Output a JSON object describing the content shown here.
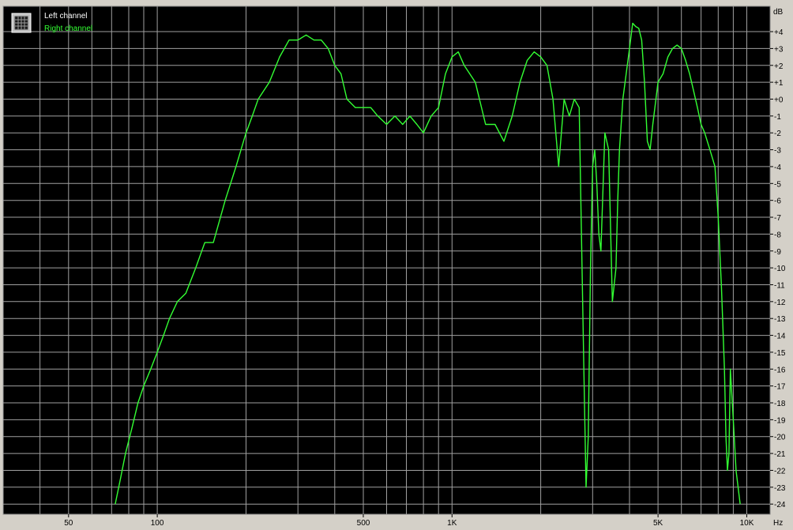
{
  "legend": {
    "icon": "spectrum-grid-icon",
    "entries": [
      {
        "label": "Left channel",
        "color": "#ffffff"
      },
      {
        "label": "Right channel",
        "color": "#33ff33"
      }
    ]
  },
  "colors": {
    "plot_background": "#000000",
    "grid": "#a0a0a0",
    "frame": "#d4d0c8",
    "axis_text": "#000000",
    "trace": "#33ff33"
  },
  "chart_data": {
    "type": "line",
    "x_scale": "log",
    "xlim": [
      30,
      12000
    ],
    "ylim": [
      -24.6,
      5.5
    ],
    "x_unit": "Hz",
    "y_unit": "dB",
    "x_ticks": [
      {
        "value": 50,
        "label": "50"
      },
      {
        "value": 100,
        "label": "100"
      },
      {
        "value": 500,
        "label": "500"
      },
      {
        "value": 1000,
        "label": "1K"
      },
      {
        "value": 5000,
        "label": "5K"
      },
      {
        "value": 10000,
        "label": "10K"
      }
    ],
    "x_gridlines": [
      30,
      40,
      50,
      60,
      70,
      80,
      90,
      100,
      200,
      300,
      400,
      500,
      600,
      700,
      800,
      900,
      1000,
      2000,
      3000,
      4000,
      5000,
      6000,
      7000,
      8000,
      9000,
      10000
    ],
    "y_ticks": [
      4,
      3,
      2,
      1,
      0,
      -1,
      -2,
      -3,
      -4,
      -5,
      -6,
      -7,
      -8,
      -9,
      -10,
      -11,
      -12,
      -13,
      -14,
      -15,
      -16,
      -17,
      -18,
      -19,
      -20,
      -21,
      -22,
      -23,
      -24
    ],
    "y_tick_labels": [
      "+4",
      "+3",
      "+2",
      "+1",
      "+0",
      "-1",
      "-2",
      "-3",
      "-4",
      "-5",
      "-6",
      "-7",
      "-8",
      "-9",
      "-10",
      "-11",
      "-12",
      "-13",
      "-14",
      "-15",
      "-16",
      "-17",
      "-18",
      "-19",
      "-20",
      "-21",
      "-22",
      "-23",
      "-24"
    ],
    "grid": true,
    "legend_position": "top-left",
    "series": [
      {
        "name": "Right channel",
        "color": "#33ff33",
        "x": [
          72,
          75,
          78,
          82,
          86,
          90,
          95,
          100,
          105,
          110,
          117,
          125,
          135,
          145,
          155,
          170,
          185,
          200,
          210,
          220,
          240,
          260,
          280,
          300,
          320,
          340,
          360,
          380,
          400,
          420,
          440,
          470,
          500,
          530,
          560,
          600,
          640,
          680,
          720,
          760,
          800,
          850,
          900,
          950,
          1000,
          1050,
          1100,
          1200,
          1300,
          1400,
          1500,
          1600,
          1700,
          1800,
          1900,
          2000,
          2100,
          2200,
          2300,
          2400,
          2500,
          2600,
          2700,
          2800,
          2850,
          2900,
          2950,
          3000,
          3050,
          3100,
          3150,
          3200,
          3300,
          3400,
          3500,
          3600,
          3650,
          3700,
          3800,
          4000,
          4100,
          4200,
          4300,
          4400,
          4500,
          4600,
          4700,
          4800,
          5000,
          5200,
          5400,
          5600,
          5800,
          6000,
          6200,
          6400,
          6600,
          6800,
          7000,
          7200,
          7500,
          7800,
          8000,
          8200,
          8400,
          8500,
          8600,
          8700,
          8800,
          9000,
          9200,
          9500
        ],
        "y": [
          -24,
          -22.5,
          -21,
          -19.5,
          -18,
          -17,
          -16,
          -15,
          -14,
          -13,
          -12,
          -11.5,
          -10,
          -8.5,
          -8.5,
          -6,
          -4,
          -2,
          -1,
          0,
          1,
          2.5,
          3.5,
          3.5,
          3.8,
          3.5,
          3.5,
          3,
          2,
          1.5,
          0,
          -0.5,
          -0.5,
          -0.5,
          -1,
          -1.5,
          -1,
          -1.5,
          -1,
          -1.5,
          -2,
          -1,
          -0.5,
          1.5,
          2.5,
          2.8,
          2,
          1,
          -1.5,
          -1.5,
          -2.5,
          -1,
          1,
          2.3,
          2.8,
          2.5,
          2,
          0,
          -4,
          0,
          -1,
          0,
          -0.5,
          -16,
          -23,
          -20,
          -10,
          -4,
          -3,
          -5,
          -8,
          -9,
          -2,
          -3,
          -12,
          -10,
          -6,
          -3,
          0,
          3,
          4.5,
          4.3,
          4.2,
          3.5,
          1,
          -2.5,
          -3,
          -1.5,
          1,
          1.5,
          2.5,
          3,
          3.2,
          3,
          2.3,
          1.5,
          0.5,
          -0.5,
          -1.5,
          -2,
          -3,
          -4,
          -7,
          -11,
          -16,
          -20,
          -22,
          -21,
          -16,
          -19,
          -22,
          -24
        ]
      }
    ]
  }
}
